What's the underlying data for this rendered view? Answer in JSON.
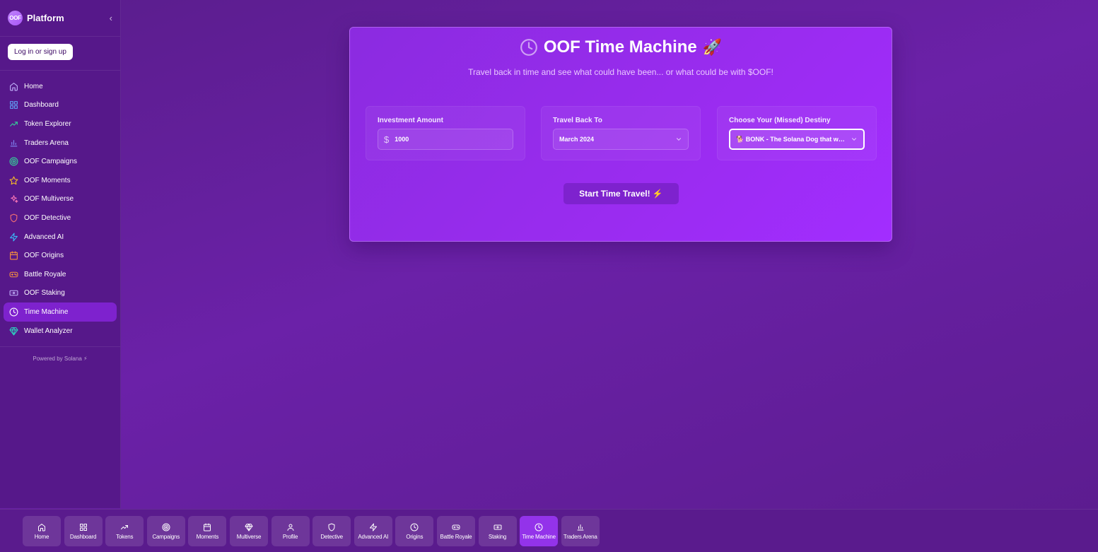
{
  "sidebar": {
    "brand_logo": "OOF",
    "brand_name": "Platform",
    "collapse_label": "‹",
    "login_label": "Log in or sign up",
    "items": [
      {
        "label": "Home",
        "icon": "home-icon",
        "color": "#c4b5fd"
      },
      {
        "label": "Dashboard",
        "icon": "grid-icon",
        "color": "#60a5fa"
      },
      {
        "label": "Token Explorer",
        "icon": "trending-up-icon",
        "color": "#34d399"
      },
      {
        "label": "Traders Arena",
        "icon": "bar-chart-icon",
        "color": "#818cf8"
      },
      {
        "label": "OOF Campaigns",
        "icon": "target-icon",
        "color": "#34d399"
      },
      {
        "label": "OOF Moments",
        "icon": "star-icon",
        "color": "#fbbf24"
      },
      {
        "label": "OOF Multiverse",
        "icon": "sparkles-icon",
        "color": "#f472b6"
      },
      {
        "label": "OOF Detective",
        "icon": "shield-icon",
        "color": "#f87171"
      },
      {
        "label": "Advanced AI",
        "icon": "zap-icon",
        "color": "#38bdf8"
      },
      {
        "label": "OOF Origins",
        "icon": "calendar-icon",
        "color": "#fb923c"
      },
      {
        "label": "Battle Royale",
        "icon": "gamepad-icon",
        "color": "#fb923c"
      },
      {
        "label": "OOF Staking",
        "icon": "wallet-icon",
        "color": "#c4b5fd"
      },
      {
        "label": "Time Machine",
        "icon": "clock-icon",
        "color": "#ffffff"
      },
      {
        "label": "Wallet Analyzer",
        "icon": "gem-icon",
        "color": "#2dd4bf"
      }
    ],
    "active_index": 12,
    "powered_by": "Powered by Solana ⚡"
  },
  "main": {
    "title": "OOF Time Machine",
    "title_emoji": "🚀",
    "subtitle": "Travel back in time and see what could have been... or what could be with $OOF!",
    "investment": {
      "label": "Investment Amount",
      "currency_symbol": "$",
      "value": "1000"
    },
    "travel_back": {
      "label": "Travel Back To",
      "value": "March 2024"
    },
    "destiny": {
      "label": "Choose Your (Missed) Destiny",
      "value": "🐕 BONK - The Solana Dog that wen..."
    },
    "start_button": "Start Time Travel! ⚡"
  },
  "bottom_nav": {
    "items": [
      {
        "label": "Home",
        "icon": "home-icon"
      },
      {
        "label": "Dashboard",
        "icon": "grid-icon"
      },
      {
        "label": "Tokens",
        "icon": "trending-up-icon"
      },
      {
        "label": "Campaigns",
        "icon": "target-icon"
      },
      {
        "label": "Moments",
        "icon": "calendar-icon"
      },
      {
        "label": "Multiverse",
        "icon": "gem-icon"
      },
      {
        "label": "Profile",
        "icon": "user-icon"
      },
      {
        "label": "Detective",
        "icon": "shield-icon"
      },
      {
        "label": "Advanced AI",
        "icon": "zap-icon"
      },
      {
        "label": "Origins",
        "icon": "clock-icon"
      },
      {
        "label": "Battle Royale",
        "icon": "gamepad-icon"
      },
      {
        "label": "Staking",
        "icon": "wallet-icon"
      },
      {
        "label": "Time Machine",
        "icon": "clock-icon"
      },
      {
        "label": "Traders Arena",
        "icon": "bar-chart-icon"
      }
    ],
    "active_index": 12
  }
}
